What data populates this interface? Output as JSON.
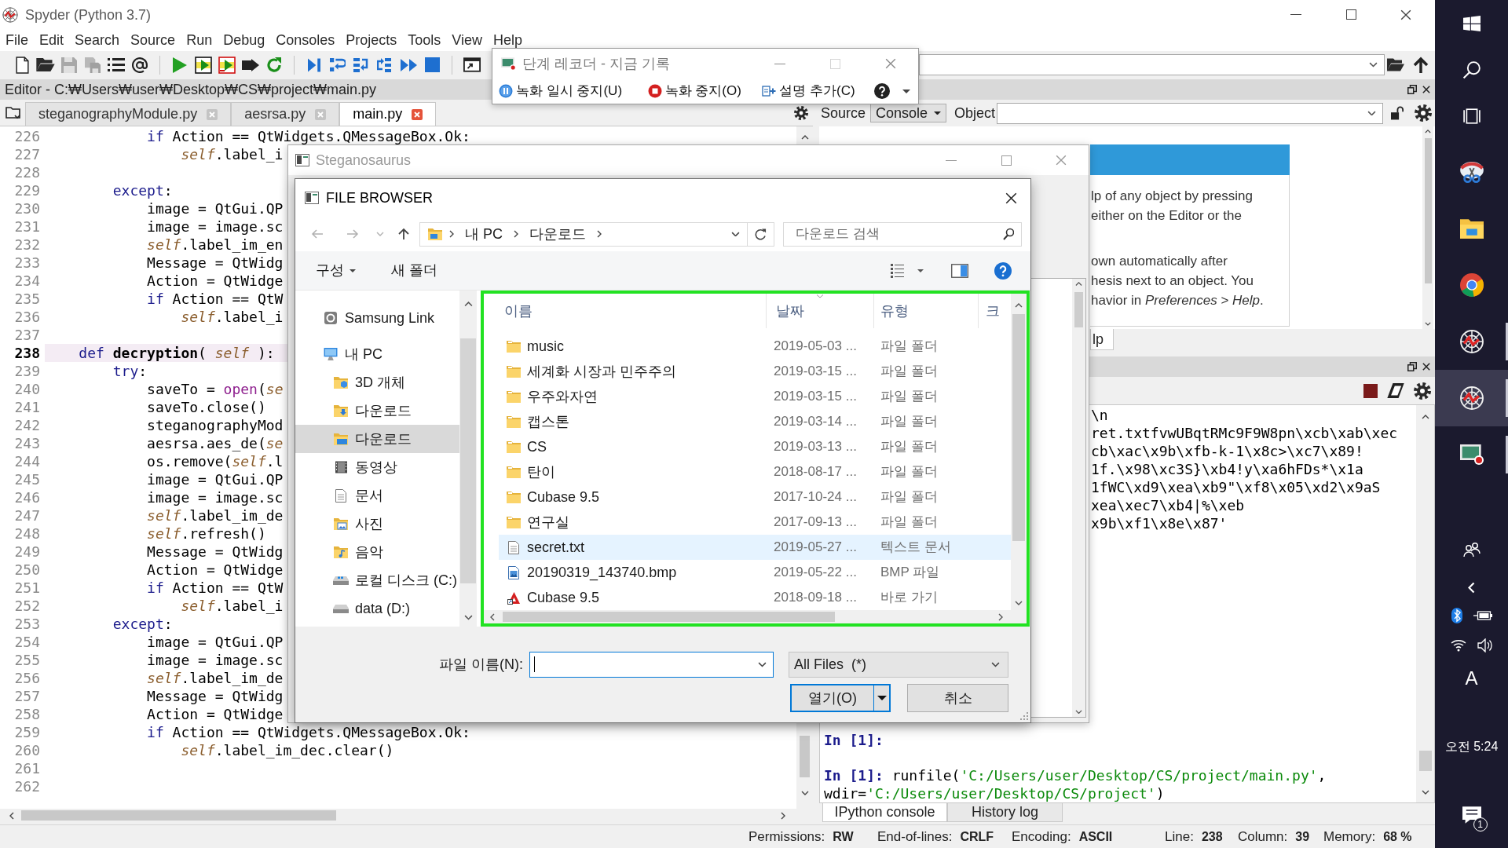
{
  "window": {
    "title": "Spyder (Python 3.7)"
  },
  "menu": [
    "File",
    "Edit",
    "Search",
    "Source",
    "Run",
    "Debug",
    "Consoles",
    "Projects",
    "Tools",
    "View",
    "Help"
  ],
  "editor": {
    "header": "Editor - C:₩Users₩user₩Desktop₩CS₩project₩main.py",
    "tabs": [
      {
        "label": "steganographyModule.py",
        "selected": false
      },
      {
        "label": "aesrsa.py",
        "selected": false
      },
      {
        "label": "main.py",
        "selected": true
      }
    ],
    "lines": [
      {
        "number": "226",
        "current": false,
        "tokens": [
          {
            "kind": "kw",
            "text": "            if"
          },
          {
            "kind": "plain",
            "text": " Action == QtWidgets.QMessageBox.Ok:"
          }
        ]
      },
      {
        "number": "227",
        "current": false,
        "tokens": [
          {
            "kind": "self",
            "text": "                self"
          },
          {
            "kind": "plain",
            "text": ".label_i"
          }
        ]
      },
      {
        "number": "228",
        "current": false
      },
      {
        "number": "229",
        "current": false,
        "tokens": [
          {
            "kind": "kw",
            "text": "        except"
          },
          {
            "kind": "plain",
            "text": ":"
          }
        ]
      },
      {
        "number": "230",
        "current": false,
        "tokens": [
          {
            "kind": "plain",
            "text": "            image = QtGui.QP"
          }
        ]
      },
      {
        "number": "231",
        "current": false,
        "tokens": [
          {
            "kind": "plain",
            "text": "            image = image.sc"
          }
        ]
      },
      {
        "number": "232",
        "current": false,
        "tokens": [
          {
            "kind": "self",
            "text": "            self"
          },
          {
            "kind": "plain",
            "text": ".label_im_en"
          }
        ]
      },
      {
        "number": "233",
        "current": false,
        "tokens": [
          {
            "kind": "plain",
            "text": "            Message = QtWidg"
          }
        ]
      },
      {
        "number": "234",
        "current": false,
        "tokens": [
          {
            "kind": "plain",
            "text": "            Action = QtWidge"
          }
        ]
      },
      {
        "number": "235",
        "current": false,
        "tokens": [
          {
            "kind": "kw",
            "text": "            if"
          },
          {
            "kind": "plain",
            "text": " Action == QtW"
          }
        ]
      },
      {
        "number": "236",
        "current": false,
        "tokens": [
          {
            "kind": "self",
            "text": "                self"
          },
          {
            "kind": "plain",
            "text": ".label_i"
          }
        ]
      },
      {
        "number": "237",
        "current": false
      },
      {
        "number": "238",
        "current": true,
        "tokens": [
          {
            "kind": "kw",
            "text": "    def"
          },
          {
            "kind": "name",
            "text": " decryption"
          },
          {
            "kind": "plain",
            "text": "( "
          },
          {
            "kind": "self",
            "text": "self"
          },
          {
            "kind": "plain",
            "text": " ):"
          }
        ]
      },
      {
        "number": "239",
        "current": false,
        "tokens": [
          {
            "kind": "kw",
            "text": "        try"
          },
          {
            "kind": "plain",
            "text": ":"
          }
        ]
      },
      {
        "number": "240",
        "current": false,
        "tokens": [
          {
            "kind": "plain",
            "text": "            saveTo = "
          },
          {
            "kind": "builtin",
            "text": "open"
          },
          {
            "kind": "plain",
            "text": "("
          },
          {
            "kind": "self",
            "text": "se"
          }
        ]
      },
      {
        "number": "241",
        "current": false,
        "tokens": [
          {
            "kind": "plain",
            "text": "            saveTo.close()"
          }
        ]
      },
      {
        "number": "242",
        "current": false,
        "tokens": [
          {
            "kind": "plain",
            "text": "            steganographyMod"
          }
        ]
      },
      {
        "number": "243",
        "current": false,
        "tokens": [
          {
            "kind": "plain",
            "text": "            aesrsa.aes_de("
          },
          {
            "kind": "self",
            "text": "se"
          }
        ]
      },
      {
        "number": "244",
        "current": false,
        "tokens": [
          {
            "kind": "plain",
            "text": "            os.remove("
          },
          {
            "kind": "self",
            "text": "self"
          },
          {
            "kind": "plain",
            "text": ".l"
          }
        ]
      },
      {
        "number": "245",
        "current": false,
        "tokens": [
          {
            "kind": "plain",
            "text": "            image = QtGui.QP"
          }
        ]
      },
      {
        "number": "246",
        "current": false,
        "tokens": [
          {
            "kind": "plain",
            "text": "            image = image.sc"
          }
        ]
      },
      {
        "number": "247",
        "current": false,
        "tokens": [
          {
            "kind": "self",
            "text": "            self"
          },
          {
            "kind": "plain",
            "text": ".label_im_de"
          }
        ]
      },
      {
        "number": "248",
        "current": false,
        "tokens": [
          {
            "kind": "self",
            "text": "            self"
          },
          {
            "kind": "plain",
            "text": ".refresh()"
          }
        ]
      },
      {
        "number": "249",
        "current": false,
        "tokens": [
          {
            "kind": "plain",
            "text": "            Message = QtWidg"
          }
        ]
      },
      {
        "number": "250",
        "current": false,
        "tokens": [
          {
            "kind": "plain",
            "text": "            Action = QtWidge"
          }
        ]
      },
      {
        "number": "251",
        "current": false,
        "tokens": [
          {
            "kind": "kw",
            "text": "            if"
          },
          {
            "kind": "plain",
            "text": " Action == QtW"
          }
        ]
      },
      {
        "number": "252",
        "current": false,
        "tokens": [
          {
            "kind": "self",
            "text": "                self"
          },
          {
            "kind": "plain",
            "text": ".label_i"
          }
        ]
      },
      {
        "number": "253",
        "current": false,
        "tokens": [
          {
            "kind": "kw",
            "text": "        except"
          },
          {
            "kind": "plain",
            "text": ":"
          }
        ]
      },
      {
        "number": "254",
        "current": false,
        "tokens": [
          {
            "kind": "plain",
            "text": "            image = QtGui.QP"
          }
        ]
      },
      {
        "number": "255",
        "current": false,
        "tokens": [
          {
            "kind": "plain",
            "text": "            image = image.sc"
          }
        ]
      },
      {
        "number": "256",
        "current": false,
        "tokens": [
          {
            "kind": "self",
            "text": "            self"
          },
          {
            "kind": "plain",
            "text": ".label_im_de"
          }
        ]
      },
      {
        "number": "257",
        "current": false,
        "tokens": [
          {
            "kind": "plain",
            "text": "            Message = QtWidg"
          }
        ]
      },
      {
        "number": "258",
        "current": false,
        "tokens": [
          {
            "kind": "plain",
            "text": "            Action = QtWidge"
          }
        ]
      },
      {
        "number": "259",
        "current": false,
        "tokens": [
          {
            "kind": "kw",
            "text": "            if"
          },
          {
            "kind": "plain",
            "text": " Action == QtWidgets.QMessageBox.Ok:"
          }
        ]
      },
      {
        "number": "260",
        "current": false,
        "tokens": [
          {
            "kind": "self",
            "text": "                self"
          },
          {
            "kind": "plain",
            "text": ".label_im_dec.clear()"
          }
        ]
      },
      {
        "number": "261",
        "current": false
      },
      {
        "number": "262",
        "current": false
      }
    ]
  },
  "help": {
    "source_label": "Source",
    "source": "Console",
    "object_label": "Object",
    "paragraphs": [
      [
        "lp of any object by pressing",
        "either on the Editor or the"
      ],
      [
        "own automatically after",
        "hesis next to an object. You",
        "havior in *Preferences > Help*."
      ]
    ],
    "tabs": [
      {
        "label": "lp",
        "selected": true
      }
    ]
  },
  "console": {
    "output": [
      "\\n",
      "ret.txtfvwUBqtRMc9F9W8pn\\xcb\\xab\\xec",
      "cb\\xac\\x9b\\xfb-k-1\\x8c>\\xc7\\x89!",
      "1f.\\x98\\xc3S}\\xb4!y\\xa6hFDs*\\x1a",
      "1fWC\\xd9\\xea\\xb9\"\\xf8\\x05\\xd2\\x9aS",
      "xea\\xec7\\xb4|%\\xeb",
      "x9b\\xf1\\x8e\\x87'"
    ],
    "history": [
      [
        {
          "kind": "prompt",
          "text": "In [1]:"
        }
      ],
      [
        {
          "kind": "prompt",
          "text": "In [1]:"
        },
        {
          "kind": "plain",
          "text": " runfile("
        },
        {
          "kind": "str",
          "text": "'C:/Users/user/Desktop/CS/project/main.py'"
        },
        {
          "kind": "plain",
          "text": ", wdir="
        },
        {
          "kind": "str",
          "text": "'C:/Users/user/Desktop/CS/project'"
        },
        {
          "kind": "plain",
          "text": ")"
        }
      ]
    ],
    "tabs": [
      {
        "label": "IPython console",
        "selected": true
      },
      {
        "label": "History log",
        "selected": false
      }
    ]
  },
  "status_bar": [
    {
      "label": "Permissions:",
      "value": "RW"
    },
    {
      "label": "End-of-lines:",
      "value": "CRLF"
    },
    {
      "label": "Encoding:",
      "value": "ASCII"
    },
    {
      "label": "Line:",
      "value": "238"
    },
    {
      "label": "Column:",
      "value": "39"
    },
    {
      "label": "Memory:",
      "value": "68 %"
    }
  ],
  "step_recorder": {
    "title": "단계 레코더 - 지금 기록",
    "buttons": [
      {
        "kind": "pause",
        "label": "녹화 일시 중지(U)"
      },
      {
        "kind": "stop",
        "label": "녹화 중지(O)"
      },
      {
        "kind": "comment",
        "label": "설명 추가(C)"
      }
    ]
  },
  "app_window": {
    "title": "Steganosaurus"
  },
  "file_dialog": {
    "title": "FILE BROWSER",
    "path": [
      "내 PC",
      "다운로드"
    ],
    "search_placeholder": "다운로드 검색",
    "commands": [
      {
        "kind": "menu",
        "label": "구성"
      },
      {
        "kind": "button",
        "label": "새 폴더"
      }
    ],
    "nav": [
      {
        "label": "Samsung Link",
        "kind": "link",
        "selected": false
      },
      {
        "label": "내 PC",
        "kind": "pc",
        "selected": false,
        "children": [
          {
            "label": "3D 개체",
            "kind": "objects",
            "selected": false
          },
          {
            "label": "다운로드",
            "kind": "downloads",
            "selected": false
          },
          {
            "label": "다운로드",
            "kind": "desktop",
            "selected": true
          },
          {
            "label": "동영상",
            "kind": "videos",
            "selected": false
          },
          {
            "label": "문서",
            "kind": "documents",
            "selected": false
          },
          {
            "label": "사진",
            "kind": "pictures",
            "selected": false
          },
          {
            "label": "음악",
            "kind": "music",
            "selected": false
          },
          {
            "label": "로컬 디스크 (C:)",
            "kind": "system-drive",
            "selected": false
          },
          {
            "label": "data (D:)",
            "kind": "drive",
            "selected": false
          }
        ]
      }
    ],
    "columns": [
      "이름",
      "날짜",
      "유형",
      "크"
    ],
    "files": [
      {
        "name": "music",
        "date": "2019-05-03 ...",
        "type": "파일 폴더",
        "kind": "folder",
        "selected": false
      },
      {
        "name": "세계화 시장과 민주주의",
        "date": "2019-03-15 ...",
        "type": "파일 폴더",
        "kind": "folder",
        "selected": false
      },
      {
        "name": "우주와자연",
        "date": "2019-03-15 ...",
        "type": "파일 폴더",
        "kind": "folder",
        "selected": false
      },
      {
        "name": "캡스톤",
        "date": "2019-03-14 ...",
        "type": "파일 폴더",
        "kind": "folder",
        "selected": false
      },
      {
        "name": "CS",
        "date": "2019-03-13 ...",
        "type": "파일 폴더",
        "kind": "folder",
        "selected": false
      },
      {
        "name": "탄이",
        "date": "2018-08-17 ...",
        "type": "파일 폴더",
        "kind": "folder",
        "selected": false
      },
      {
        "name": "Cubase 9.5",
        "date": "2017-10-24 ...",
        "type": "파일 폴더",
        "kind": "folder",
        "selected": false
      },
      {
        "name": "연구실",
        "date": "2017-09-13 ...",
        "type": "파일 폴더",
        "kind": "folder",
        "selected": false
      },
      {
        "name": "secret.txt",
        "date": "2019-05-27 ...",
        "type": "텍스트 문서",
        "kind": "text",
        "selected": true
      },
      {
        "name": "20190319_143740.bmp",
        "date": "2019-05-22 ...",
        "type": "BMP 파일",
        "kind": "image",
        "selected": false
      },
      {
        "name": "Cubase 9.5",
        "date": "2018-09-18 ...",
        "type": "바로 가기",
        "kind": "shortcut",
        "selected": false
      }
    ],
    "filename_label": "파일 이름(N):",
    "filter": "All Files  (*)",
    "open_button": "열기(O)",
    "cancel_button": "취소"
  },
  "taskbar": {
    "apps": [
      {
        "kind": "snip",
        "selected": false,
        "running": false
      },
      {
        "kind": "explorer",
        "selected": false,
        "running": false
      },
      {
        "kind": "browser",
        "selected": false,
        "running": false
      },
      {
        "kind": "spyder",
        "selected": false,
        "running": true
      },
      {
        "kind": "spyder",
        "selected": true,
        "running": true
      },
      {
        "kind": "recorder",
        "selected": false,
        "running": true
      }
    ],
    "ime": "A",
    "clock": "오전 5:24",
    "notifications": "1"
  }
}
